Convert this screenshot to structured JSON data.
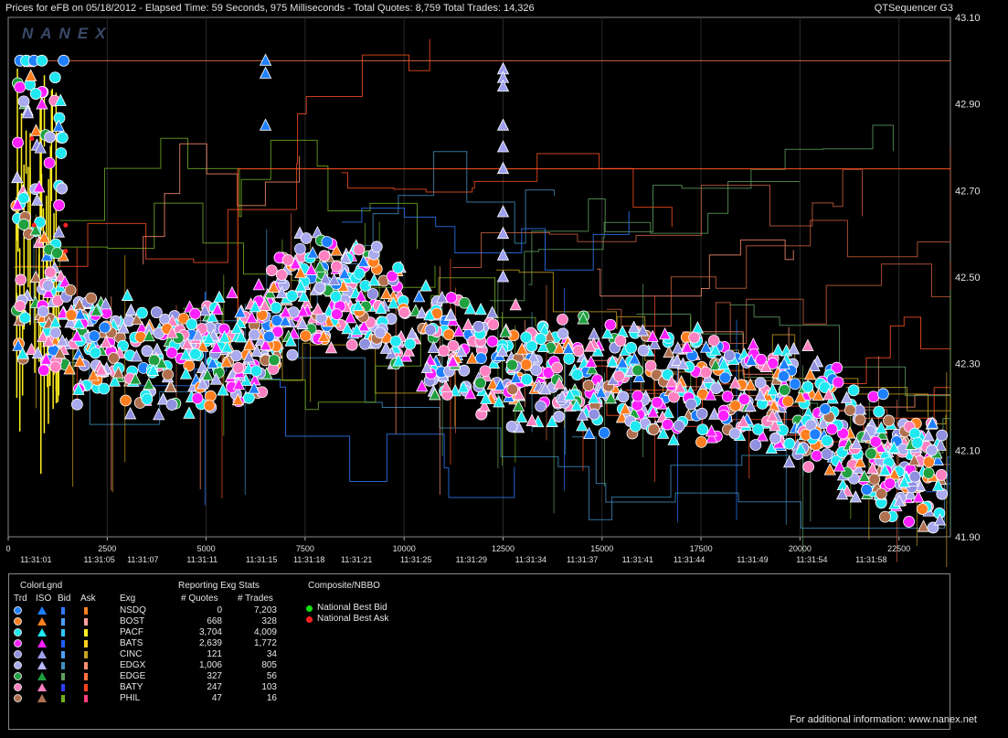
{
  "header": {
    "left_text": "Prices for  eFB  on  05/18/2012  -  Elapsed Time: 59 Seconds, 975 Milliseconds  -  Total Quotes: 8,759  Total Trades: 14,326",
    "right_text": "QTSequencer G3"
  },
  "watermark": "NANEX",
  "chart_data": {
    "type": "scatter",
    "title": "Prices for  eFB  on  05/18/2012",
    "ylim": [
      41.9,
      43.1
    ],
    "y_ticks": [
      "43.10",
      "42.90",
      "42.70",
      "42.50",
      "42.30",
      "42.10",
      "41.90"
    ],
    "y_tick_values": [
      43.1,
      42.9,
      42.7,
      42.5,
      42.3,
      42.1,
      41.9
    ],
    "xlim": [
      0,
      23800
    ],
    "x_ticks": [
      "0",
      "2500",
      "5000",
      "7500",
      "10000",
      "12500",
      "15000",
      "17500",
      "20000",
      "22500"
    ],
    "x_tick_values": [
      0,
      2500,
      5000,
      7500,
      10000,
      12500,
      15000,
      17500,
      20000,
      22500
    ],
    "time_labels": [
      "11:31:01",
      "11:31:05",
      "11:31:07",
      "11:31:11",
      "11:31:15",
      "11:31:18",
      "11:31:21",
      "11:31:25",
      "11:31:29",
      "11:31:34",
      "11:31:37",
      "11:31:41",
      "11:31:44",
      "11:31:49",
      "11:31:54",
      "11:31:58"
    ],
    "time_label_values": [
      700,
      2300,
      3400,
      4900,
      6400,
      7600,
      8800,
      10300,
      11700,
      13200,
      14500,
      15900,
      17200,
      18800,
      20300,
      21800
    ],
    "trend": [
      [
        0,
        42.6
      ],
      [
        600,
        42.45
      ],
      [
        1500,
        42.35
      ],
      [
        3000,
        42.32
      ],
      [
        4500,
        42.3
      ],
      [
        5500,
        42.32
      ],
      [
        6200,
        42.35
      ],
      [
        7000,
        42.45
      ],
      [
        8000,
        42.47
      ],
      [
        9000,
        42.46
      ],
      [
        10000,
        42.4
      ],
      [
        11000,
        42.32
      ],
      [
        12500,
        42.3
      ],
      [
        14000,
        42.28
      ],
      [
        15500,
        42.26
      ],
      [
        17000,
        42.25
      ],
      [
        18500,
        42.24
      ],
      [
        19500,
        42.22
      ],
      [
        20500,
        42.18
      ],
      [
        21500,
        42.1
      ],
      [
        22500,
        42.06
      ],
      [
        23600,
        42.04
      ]
    ],
    "spike_series": [
      {
        "name": "triangle-spike-1",
        "x": 6500,
        "y": [
          43.0,
          42.97,
          42.85
        ]
      },
      {
        "name": "triangle-spike-2",
        "x": 12500,
        "y": [
          42.98,
          42.96,
          42.94,
          42.85,
          42.8,
          42.75,
          42.65,
          42.6,
          42.55,
          42.5
        ]
      }
    ],
    "early_cluster": {
      "x": [
        200,
        1400
      ],
      "y": [
        42.3,
        43.0
      ]
    },
    "isolated_points": [
      {
        "x": 22100,
        "y": 42.23
      }
    ]
  },
  "legend": {
    "colorlgnd_title": "ColorLgnd",
    "col_headers": [
      "Trd",
      "ISO",
      "Bid",
      "Ask",
      "Exg"
    ],
    "stats_title": "Reporting Exg Stats",
    "stats_headers": [
      "# Quotes",
      "# Trades"
    ],
    "composite_title": "Composite/NBBO",
    "rows": [
      {
        "exg": "NSDQ",
        "quotes": "0",
        "trades": "7,203",
        "trd": "#1e7fff",
        "iso": "#1e7fff",
        "bid": "#2e7bff",
        "ask": "#ff8020"
      },
      {
        "exg": "BOST",
        "quotes": "668",
        "trades": "328",
        "trd": "#ff7f20",
        "iso": "#ff7f20",
        "bid": "#4aa0ff",
        "ask": "#ff9fa0"
      },
      {
        "exg": "PACF",
        "quotes": "3,704",
        "trades": "4,009",
        "trd": "#20e8f0",
        "iso": "#20e8f0",
        "bid": "#30c8ff",
        "ask": "#ffee20"
      },
      {
        "exg": "BATS",
        "quotes": "2,639",
        "trades": "1,772",
        "trd": "#ff20ff",
        "iso": "#ff20ff",
        "bid": "#2060ff",
        "ask": "#ffd020"
      },
      {
        "exg": "CINC",
        "quotes": "121",
        "trades": "34",
        "trd": "#9090e0",
        "iso": "#a0a0f0",
        "bid": "#4aa0ff",
        "ask": "#c8a020"
      },
      {
        "exg": "EDGX",
        "quotes": "1,006",
        "trades": "805",
        "trd": "#aaaaee",
        "iso": "#b8b8ff",
        "bid": "#4090c0",
        "ask": "#ff9070"
      },
      {
        "exg": "EDGE",
        "quotes": "327",
        "trades": "56",
        "trd": "#20a040",
        "iso": "#20a040",
        "bid": "#60a060",
        "ask": "#ff7040"
      },
      {
        "exg": "BATY",
        "quotes": "247",
        "trades": "103",
        "trd": "#ff80c0",
        "iso": "#ff80c0",
        "bid": "#3040ff",
        "ask": "#ff4020"
      },
      {
        "exg": "PHIL",
        "quotes": "47",
        "trades": "16",
        "trd": "#b07050",
        "iso": "#b07050",
        "bid": "#70b020",
        "ask": "#ff4080"
      }
    ],
    "nbbo": [
      {
        "label": "National Best Bid",
        "color": "#10e010"
      },
      {
        "label": "National Best Ask",
        "color": "#ff2020"
      }
    ]
  },
  "footer_note": "For additional information: www.nanex.net"
}
